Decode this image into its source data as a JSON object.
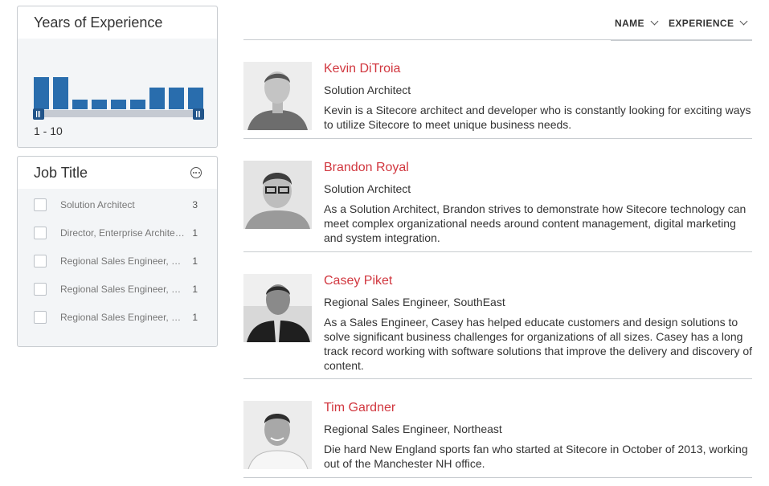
{
  "experience_facet": {
    "title": "Years of Experience",
    "histogram": [
      0.83,
      0.83,
      0.25,
      0.25,
      0.25,
      0.25,
      0.56,
      0.56,
      0.56
    ],
    "range_label": "1 - 10"
  },
  "job_facet": {
    "title": "Job Title",
    "more_icon": "more-options-icon",
    "values": [
      {
        "label": "Solution Architect",
        "count": "3"
      },
      {
        "label": "Director, Enterprise Architecture",
        "count": "1"
      },
      {
        "label": "Regional Sales Engineer, Northeast",
        "count": "1"
      },
      {
        "label": "Regional Sales Engineer, SouthEast",
        "count": "1"
      },
      {
        "label": "Regional Sales Engineer, West",
        "count": "1"
      }
    ]
  },
  "sort": {
    "name_label": "NAME",
    "experience_label": "EXPERIENCE"
  },
  "results": [
    {
      "name": "Kevin DiTroia",
      "title": "Solution Architect",
      "description": "Kevin is a Sitecore architect and developer who is constantly looking for exciting ways to utilize Sitecore to meet unique business needs."
    },
    {
      "name": "Brandon Royal",
      "title": "Solution Architect",
      "description": "As a Solution Architect, Brandon strives to demonstrate how Sitecore technology can meet complex organizational needs around content management, digital marketing and system integration."
    },
    {
      "name": "Casey Piket",
      "title": "Regional Sales Engineer, SouthEast",
      "description": "As a Sales Engineer, Casey has helped educate customers and design solutions to solve significant business challenges for organizations of all sizes. Casey has a long track record working with software solutions that improve the delivery and discovery of content."
    },
    {
      "name": "Tim Gardner",
      "title": "Regional Sales Engineer, Northeast",
      "description": "Die hard New England sports fan who started at Sitecore in October of 2013, working out of the Manchester NH office."
    }
  ],
  "colors": {
    "accent_red": "#d1373f",
    "bar_blue": "#296dad"
  }
}
